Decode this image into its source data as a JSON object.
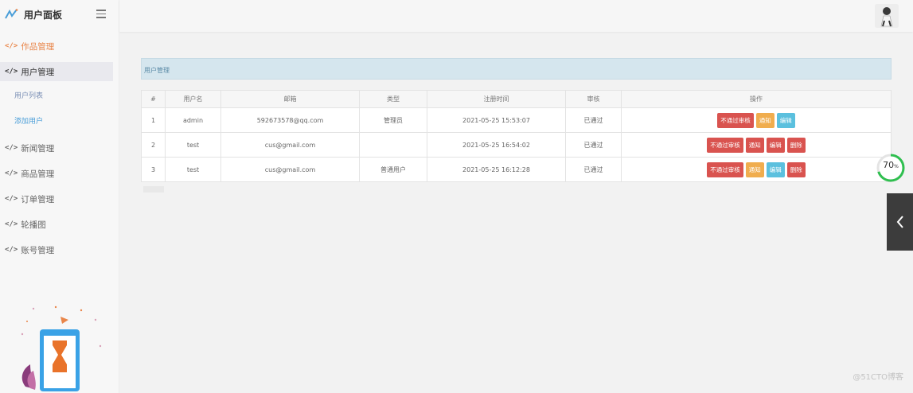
{
  "brand": {
    "title": "用户面板"
  },
  "nav": {
    "items": [
      {
        "label": "作品管理"
      },
      {
        "label": "用户管理"
      },
      {
        "label": "新闻管理"
      },
      {
        "label": "商品管理"
      },
      {
        "label": "订单管理"
      },
      {
        "label": "轮播图"
      },
      {
        "label": "账号管理"
      }
    ],
    "subitems": [
      {
        "label": "用户列表"
      },
      {
        "label": "添加用户"
      }
    ],
    "code_glyph": "</>"
  },
  "panel": {
    "title": "用户管理"
  },
  "table": {
    "headers": [
      "#",
      "用户名",
      "邮箱",
      "类型",
      "注册时间",
      "审核",
      "操作"
    ],
    "rows": [
      {
        "id": "1",
        "username": "admin",
        "email": "592673578@qq.com",
        "type": "管理员",
        "time": "2021-05-25 15:53:07",
        "status": "已通过",
        "actions": [
          "不通过审核",
          "通知",
          "编辑"
        ]
      },
      {
        "id": "2",
        "username": "test",
        "email": "cus@gmail.com",
        "type": "",
        "time": "2021-05-25 16:54:02",
        "status": "已通过",
        "actions": [
          "不通过审核",
          "通知",
          "编辑",
          "删除"
        ]
      },
      {
        "id": "3",
        "username": "test",
        "email": "cus@gmail.com",
        "type": "普通用户",
        "time": "2021-05-25 16:12:28",
        "status": "已通过",
        "actions": [
          "不通过审核",
          "通知",
          "编辑",
          "删除"
        ]
      }
    ]
  },
  "progress": {
    "value": "70",
    "unit": "%",
    "fraction": 0.7
  },
  "watermark": "@51CTO博客",
  "colors": {
    "accent_orange": "#e9864a",
    "danger": "#d9534f",
    "warning": "#f0ad4e",
    "info": "#5bc0de",
    "progress": "#2fbf4f"
  }
}
